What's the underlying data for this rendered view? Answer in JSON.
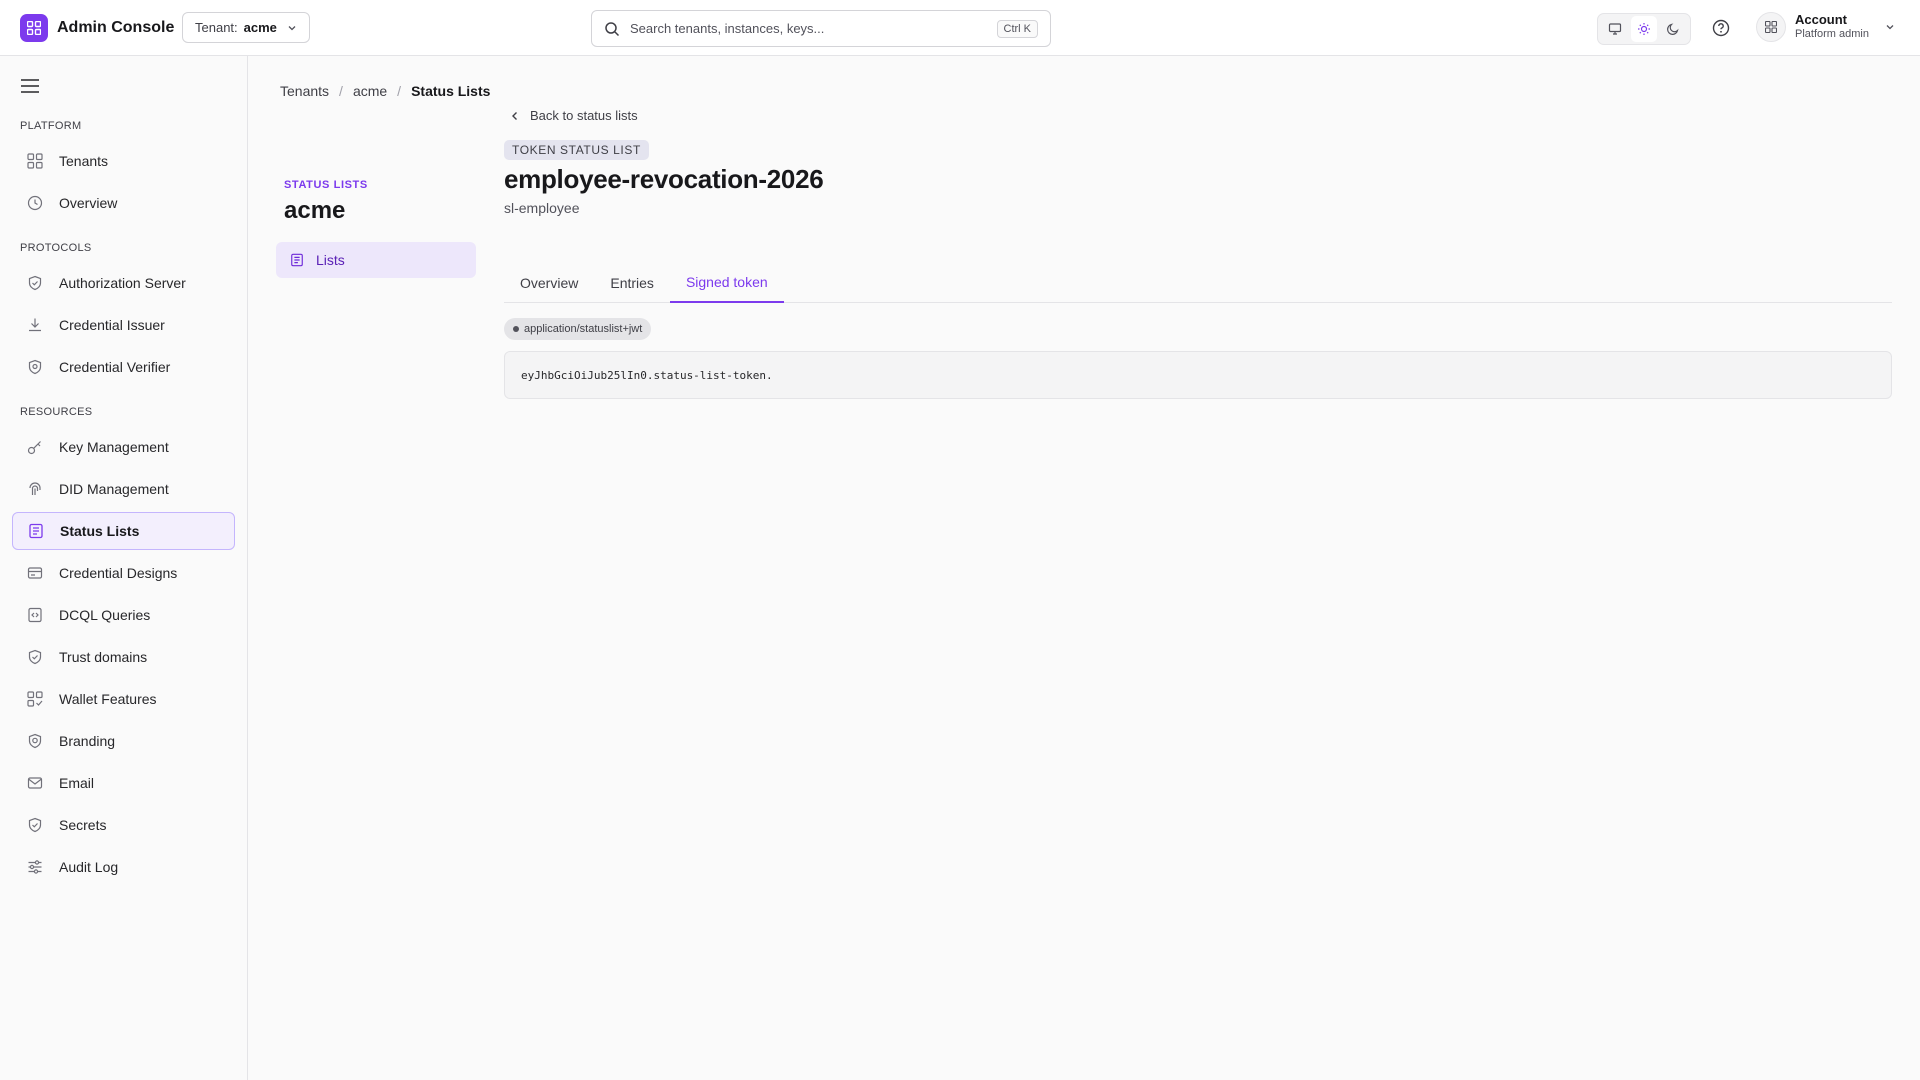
{
  "header": {
    "app_title": "Admin Console",
    "tenant_label": "Tenant:",
    "tenant_value": "acme",
    "search_placeholder": "Search tenants, instances, keys...",
    "search_shortcut": "Ctrl K",
    "account_name": "Account",
    "account_role": "Platform admin",
    "accent_color": "#7c3aed"
  },
  "sidebar": {
    "sections": [
      {
        "label": "PLATFORM",
        "items": [
          {
            "label": "Tenants",
            "icon": "grid-icon"
          },
          {
            "label": "Overview",
            "icon": "clock-icon"
          }
        ]
      },
      {
        "label": "PROTOCOLS",
        "items": [
          {
            "label": "Authorization Server",
            "icon": "shield-check-icon"
          },
          {
            "label": "Credential Issuer",
            "icon": "download-icon"
          },
          {
            "label": "Credential Verifier",
            "icon": "shield-search-icon"
          }
        ]
      },
      {
        "label": "RESOURCES",
        "items": [
          {
            "label": "Key Management",
            "icon": "key-icon"
          },
          {
            "label": "DID Management",
            "icon": "fingerprint-icon"
          },
          {
            "label": "Status Lists",
            "icon": "list-document-icon",
            "active": true
          },
          {
            "label": "Credential Designs",
            "icon": "id-card-icon"
          },
          {
            "label": "DCQL Queries",
            "icon": "code-file-icon"
          },
          {
            "label": "Trust domains",
            "icon": "shield-check-icon"
          },
          {
            "label": "Wallet Features",
            "icon": "grid-check-icon"
          },
          {
            "label": "Branding",
            "icon": "badge-shield-icon"
          },
          {
            "label": "Email",
            "icon": "mail-icon"
          },
          {
            "label": "Secrets",
            "icon": "shield-check-icon"
          },
          {
            "label": "Audit Log",
            "icon": "sliders-icon"
          }
        ]
      }
    ]
  },
  "breadcrumb": [
    "Tenants",
    "acme",
    "Status Lists"
  ],
  "sub_sidebar": {
    "eyebrow": "STATUS LISTS",
    "title": "acme",
    "item_label": "Lists"
  },
  "detail": {
    "back_label": "Back to status lists",
    "kind_badge": "TOKEN STATUS LIST",
    "title": "employee-revocation-2026",
    "subtitle": "sl-employee",
    "tabs": [
      {
        "label": "Overview"
      },
      {
        "label": "Entries"
      },
      {
        "label": "Signed token",
        "active": true
      }
    ],
    "media_type": "application/statuslist+jwt",
    "token": "eyJhbGciOiJub25lIn0.status-list-token."
  }
}
